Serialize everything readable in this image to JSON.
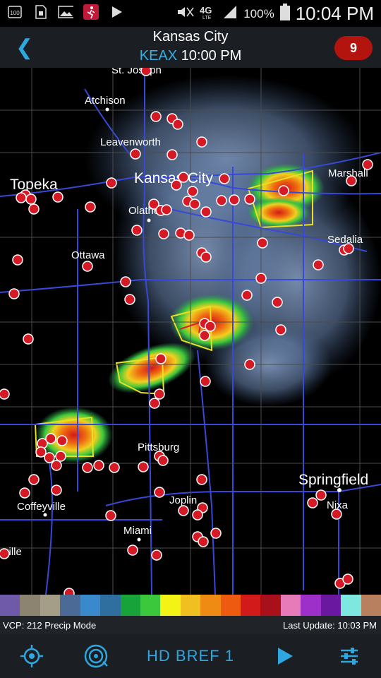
{
  "status_bar": {
    "icons": [
      "battery-100-icon",
      "sd-card-icon",
      "gallery-icon",
      "fitness-app-icon",
      "play-store-icon"
    ],
    "right_icons": [
      "mute-icon",
      "4g-lte-icon",
      "signal-icon",
      "battery-icon"
    ],
    "battery": "100%",
    "time": "10:04 PM"
  },
  "header": {
    "title": "Kansas City",
    "station": "KEAX",
    "scan_time": "10:00 PM",
    "alert_count": "9",
    "colors": {
      "accent": "#2ea7e0",
      "badge": "#b3140e"
    }
  },
  "map": {
    "cities": [
      {
        "name": "St. Joseph",
        "label": "St. Joseph"
      },
      {
        "name": "Atchison",
        "label": "Atchison"
      },
      {
        "name": "Leavenworth",
        "label": "Leavenworth"
      },
      {
        "name": "Topeka",
        "label": "Topeka"
      },
      {
        "name": "Kansas City",
        "label": "Kansas City"
      },
      {
        "name": "Olathe",
        "label": "Olathe"
      },
      {
        "name": "Marshall",
        "label": "Marshall"
      },
      {
        "name": "Sedalia",
        "label": "Sedalia"
      },
      {
        "name": "Ottawa",
        "label": "Ottawa"
      },
      {
        "name": "Pittsburg",
        "label": "Pittsburg"
      },
      {
        "name": "Springfield",
        "label": "Springfield"
      },
      {
        "name": "Nixa",
        "label": "Nixa"
      },
      {
        "name": "Coffeyville",
        "label": "Coffeyville"
      },
      {
        "name": "Joplin",
        "label": "Joplin"
      },
      {
        "name": "Miami",
        "label": "Miami"
      },
      {
        "name": "Bartlesville",
        "label": "ville"
      }
    ]
  },
  "legend": {
    "colors": [
      "#6e5aa8",
      "#8c8470",
      "#a49e88",
      "#4c6a96",
      "#3a8acb",
      "#2f6fa0",
      "#17a33a",
      "#3cc83c",
      "#f3f316",
      "#f0c020",
      "#ef8a12",
      "#ee5a10",
      "#d21a1a",
      "#a8101a",
      "#e77ab8",
      "#9c30c8",
      "#6a18a0",
      "#7ee8e0",
      "#b98060"
    ]
  },
  "info": {
    "vcp": "VCP: 212 Precip Mode",
    "last_update": "Last Update: 10:03 PM"
  },
  "toolbar": {
    "product": "HD BREF 1",
    "icons": [
      "locate-icon",
      "radar-refresh-icon",
      "play-icon",
      "settings-sliders-icon"
    ]
  }
}
